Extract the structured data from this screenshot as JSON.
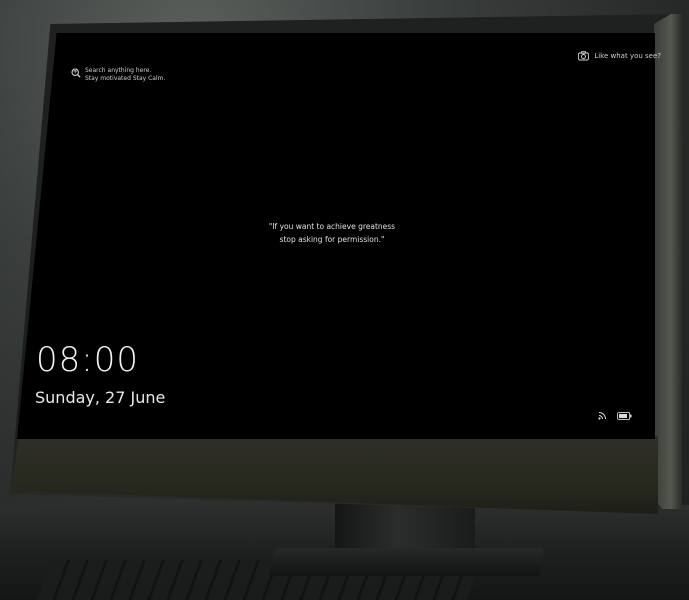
{
  "search": {
    "line1": "Search anything here.",
    "line2": "Stay motivated Stay Calm."
  },
  "like": {
    "label": "Like what you see?",
    "icon": "camera-icon"
  },
  "quote": {
    "line1": "\"If you want to achieve greatness",
    "line2": "stop asking for permission.\""
  },
  "clock": {
    "time": "08:00",
    "date": "Sunday, 27 June"
  },
  "status": {
    "icons": [
      "signal-icon",
      "battery-icon"
    ]
  },
  "colors": {
    "screen": "#000000",
    "text": "#e6e6e6"
  }
}
